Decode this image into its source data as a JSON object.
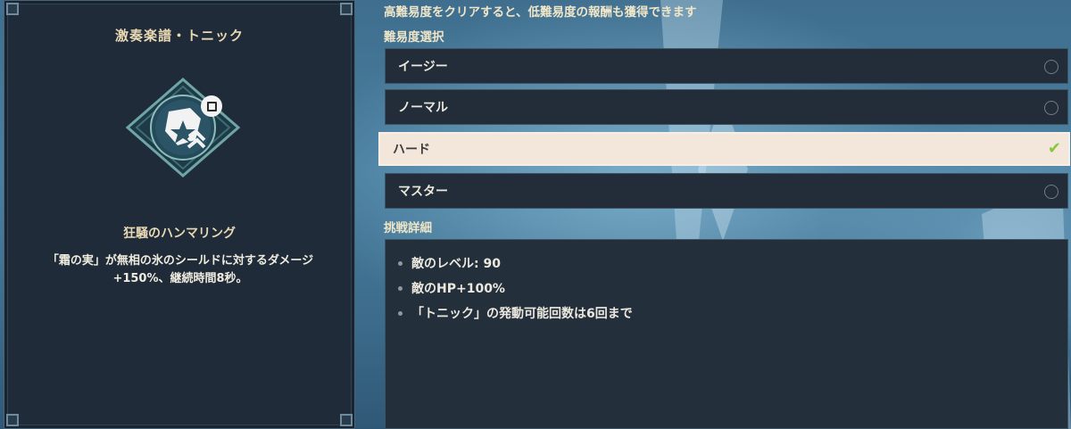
{
  "card": {
    "title": "激奏楽譜・トニック",
    "effect_name": "狂騒のハンマリング",
    "effect_desc_line1": "「霜の実」が無相の氷のシールドに対するダメージ",
    "effect_desc_line2": "+150%、継続時間8秒。",
    "icon": "shield-burst-icon"
  },
  "hint": "高難易度をクリアすると、低難易度の報酬も獲得できます",
  "difficulty": {
    "label": "難易度選択",
    "options": [
      {
        "label": "イージー",
        "selected": false
      },
      {
        "label": "ノーマル",
        "selected": false
      },
      {
        "label": "ハード",
        "selected": true
      },
      {
        "label": "マスター",
        "selected": false
      }
    ]
  },
  "details": {
    "label": "挑戦詳細",
    "items": [
      "敵のレベル: 90",
      "敵のHP+100%",
      "「トニック」の発動可能回数は6回まで"
    ]
  },
  "colors": {
    "accent_gold": "#e9d9b4",
    "selected_bg": "#f3e7dc",
    "check_green": "#8cc63f"
  }
}
